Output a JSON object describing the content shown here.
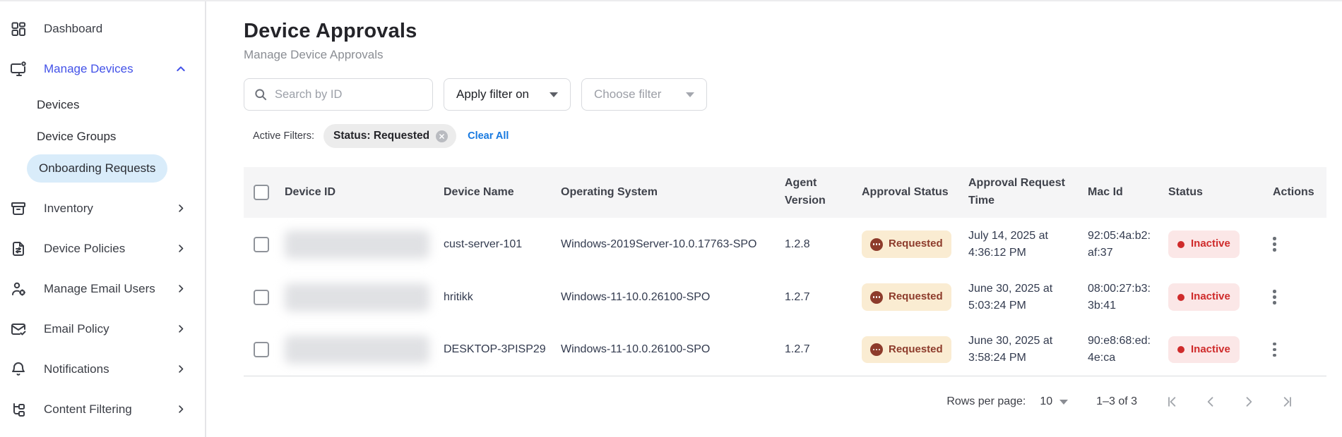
{
  "colors": {
    "accent": "#4352e8",
    "selected_pill": "#d9ecfa",
    "link": "#1779e0",
    "requested_bg": "#faecd2",
    "requested_fg": "#8d3b2b",
    "inactive_bg": "#fbe7e7",
    "inactive_fg": "#cf2b2b",
    "table_header_bg": "#f5f5f6"
  },
  "icons": {
    "sidebar": [
      "dashboard-grid-icon",
      "monitor-device-icon",
      "inventory-box-icon",
      "policy-document-icon",
      "user-gear-icon",
      "envelope-check-icon",
      "bell-icon",
      "content-tree-icon"
    ],
    "other": [
      "search-icon",
      "caret-down-icon",
      "chevron-up-icon",
      "chevron-right-icon",
      "close-circle-icon",
      "kebab-menu-icon",
      "first-page-icon",
      "prev-page-icon",
      "next-page-icon",
      "last-page-icon"
    ]
  },
  "sidebar": {
    "items": [
      {
        "label": "Dashboard"
      },
      {
        "label": "Manage Devices",
        "state": "expanded, active"
      },
      {
        "label": "Devices",
        "sub": true
      },
      {
        "label": "Device Groups",
        "sub": true
      },
      {
        "label": "Onboarding Requests",
        "sub": true,
        "selected": true
      },
      {
        "label": "Inventory"
      },
      {
        "label": "Device Policies"
      },
      {
        "label": "Manage Email Users"
      },
      {
        "label": "Email Policy"
      },
      {
        "label": "Notifications"
      },
      {
        "label": "Content Filtering"
      }
    ]
  },
  "header": {
    "title": "Device Approvals",
    "subtitle": "Manage Device Approvals"
  },
  "filters": {
    "search_placeholder": "Search by ID",
    "apply_filter_label": "Apply filter on",
    "choose_filter_label": "Choose filter",
    "active_filters_label": "Active Filters:",
    "chip_label": "Status: Requested",
    "clear_all_label": "Clear All"
  },
  "table": {
    "columns": [
      "Device ID",
      "Device Name",
      "Operating System",
      "Agent Version",
      "Approval Status",
      "Approval Request Time",
      "Mac Id",
      "Status",
      "Actions"
    ],
    "rows": [
      {
        "device_id": "(blurred)",
        "device_name": "cust-server-101",
        "os": "Windows-2019Server-10.0.17763-SPO",
        "agent_version": "1.2.8",
        "approval_status": "Requested",
        "request_time": "July 14, 2025 at 4:36:12 PM",
        "mac": "92:05:4a:b2:af:37",
        "status": "Inactive"
      },
      {
        "device_id": "(blurred)",
        "device_name": "hritikk",
        "os": "Windows-11-10.0.26100-SPO",
        "agent_version": "1.2.7",
        "approval_status": "Requested",
        "request_time": "June 30, 2025 at 5:03:24 PM",
        "mac": "08:00:27:b3:3b:41",
        "status": "Inactive"
      },
      {
        "device_id": "(blurred)",
        "device_name": "DESKTOP-3PISP29",
        "os": "Windows-11-10.0.26100-SPO",
        "agent_version": "1.2.7",
        "approval_status": "Requested",
        "request_time": "June 30, 2025 at 3:58:24 PM",
        "mac": "90:e8:68:ed:4e:ca",
        "status": "Inactive"
      }
    ]
  },
  "footer": {
    "rows_per_page_label": "Rows per page:",
    "rows_per_page_value": "10",
    "range_label": "1–3 of 3"
  }
}
